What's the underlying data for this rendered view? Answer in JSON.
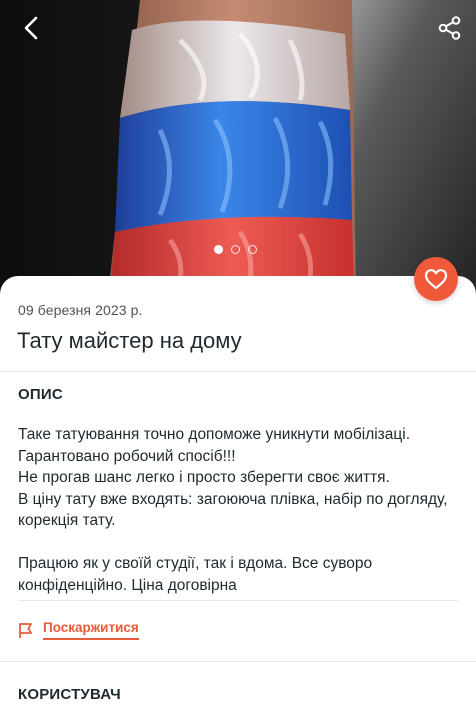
{
  "gallery": {
    "slide_count": 3,
    "active_slide": 1
  },
  "icons": {
    "back": "chevron-left-icon",
    "share": "share-icon",
    "favorite": "heart-icon",
    "report": "flag-icon"
  },
  "colors": {
    "accent": "#f05a3b",
    "report_text": "#e85a3c",
    "text": "#1f2a2e",
    "muted": "#4d5458"
  },
  "listing": {
    "date": "09 березня 2023 р.",
    "title": "Тату майстер на дому"
  },
  "description": {
    "heading": "ОПИС",
    "lines": [
      "Таке татуювання точно допоможе уникнути мобілізаці.",
      "Гарантовано робочий спосіб!!!",
      "Не прогав шанс легко і просто зберегти своє життя.",
      "В ціну тату вже входять: загоююча плівка, набір по догляду, корекція тату.",
      "Працюю як у своїй студії, так і вдома. Все суворо конфіденційно. Ціна договірна"
    ]
  },
  "report": {
    "label": "Поскаржитися"
  },
  "user_section": {
    "heading": "КОРИСТУВАЧ"
  }
}
